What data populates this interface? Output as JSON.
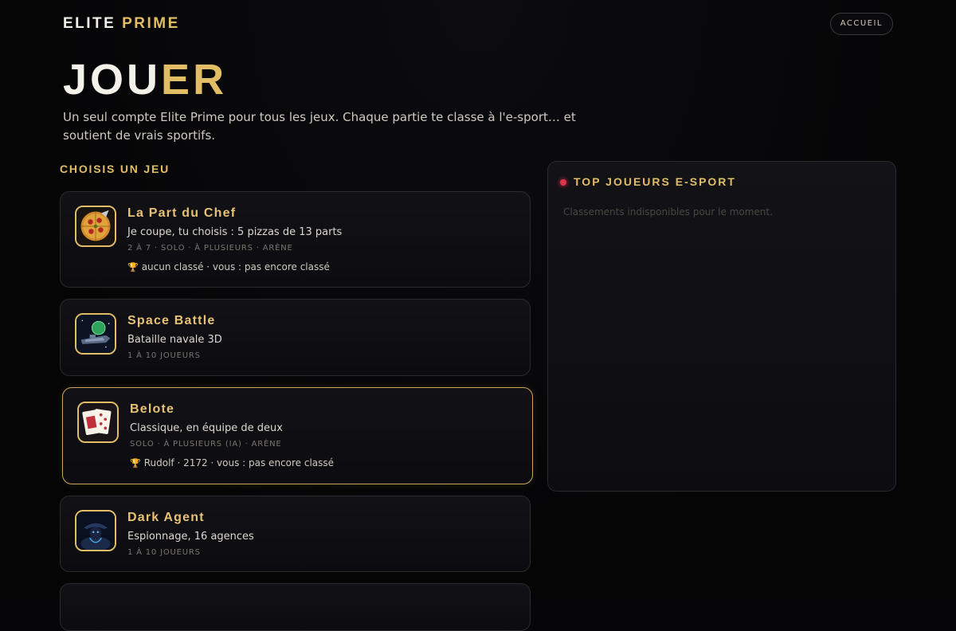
{
  "header": {
    "brand_main": "ELITE",
    "brand_accent": "PRIME",
    "home_label": "ACCUEIL"
  },
  "hero": {
    "title_main": "JOU",
    "title_accent": "ER",
    "subtitle": "Un seul compte Elite Prime pour tous les jeux. Chaque partie te classe à l'e-sport… et soutient de vrais sportifs."
  },
  "games_section": {
    "title": "CHOISIS UN JEU",
    "games": [
      {
        "title": "La Part du Chef",
        "description": "Je coupe, tu choisis : 5 pizzas de 13 parts",
        "meta": "2 À 7 · SOLO · À PLUSIEURS · ARÈNE",
        "rank": "aucun classé  ·  vous : pas encore classé",
        "icon": "pizza-icon"
      },
      {
        "title": "Space Battle",
        "description": "Bataille navale 3D",
        "meta": "1 À 10 JOUEURS",
        "icon": "spaceship-icon"
      },
      {
        "title": "Belote",
        "description": "Classique, en équipe de deux",
        "meta": "SOLO · À PLUSIEURS (IA) · ARÈNE",
        "rank": "Rudolf · 2172  ·  vous : pas encore classé",
        "icon": "playing-cards-icon"
      },
      {
        "title": "Dark Agent",
        "description": "Espionnage, 16 agences",
        "meta": "1 À 10 JOUEURS",
        "icon": "spy-agent-icon"
      }
    ]
  },
  "leaderboard": {
    "title": "TOP JOUEURS E-SPORT",
    "empty_message": "Classements indisponibles pour le moment."
  },
  "colors": {
    "background": "#060608",
    "accent_gold": "#e2bd66",
    "live_dot": "#e0344a",
    "card_border": "#2a2a2f"
  }
}
